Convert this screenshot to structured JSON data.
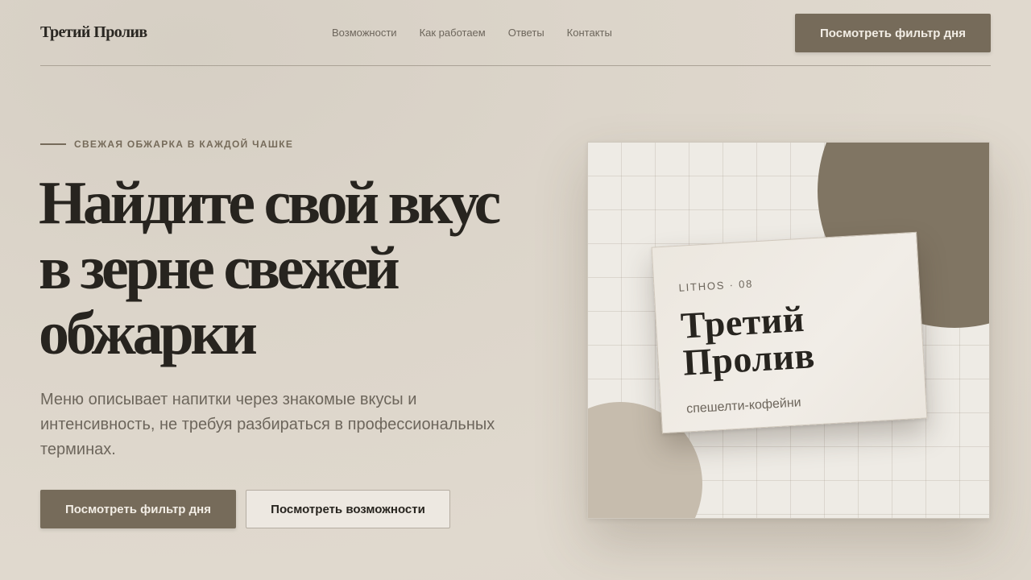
{
  "header": {
    "logo": "Третий Пролив",
    "nav": [
      {
        "label": "Возможности"
      },
      {
        "label": "Как работаем"
      },
      {
        "label": "Ответы"
      },
      {
        "label": "Контакты"
      }
    ],
    "cta_label": "Посмотреть фильтр дня"
  },
  "hero": {
    "eyebrow": "СВЕЖАЯ ОБЖАРКА В КАЖДОЙ ЧАШКЕ",
    "headline": "Найдите свой вкус в зерне свежей обжарки",
    "lead": "Меню описывает напитки через знакомые вкусы и интенсивность, не требуя разбираться в профессиональных терминах.",
    "primary_button": "Посмотреть фильтр дня",
    "secondary_button": "Посмотреть возможности"
  },
  "visual": {
    "card": {
      "kicker": "LITHOS · 08",
      "title": "Третий Пролив",
      "subtitle": "спешелти-кофейни"
    }
  },
  "colors": {
    "background": "#ddd6cb",
    "accent": "#766b5a",
    "text": "#27241f",
    "muted": "#6d665c",
    "blob_dark": "#807563",
    "blob_light": "#c6bcad"
  }
}
